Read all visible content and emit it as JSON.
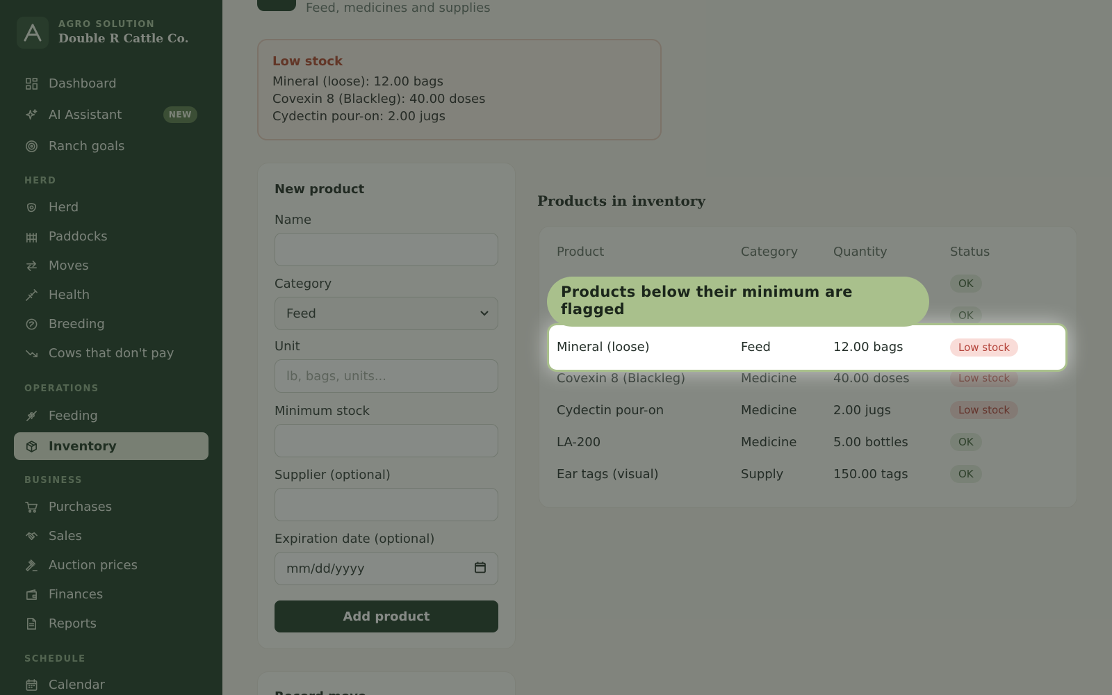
{
  "brand": {
    "kicker": "AGRO SOLUTION",
    "name": "Double R Cattle Co."
  },
  "nav": {
    "dashboard": "Dashboard",
    "ai_assistant": "AI Assistant",
    "new_badge": "NEW",
    "ranch_goals": "Ranch goals",
    "section_herd": "HERD",
    "herd": "Herd",
    "paddocks": "Paddocks",
    "moves": "Moves",
    "health": "Health",
    "breeding": "Breeding",
    "cows_dont_pay": "Cows that don't pay",
    "section_operations": "OPERATIONS",
    "feeding": "Feeding",
    "inventory": "Inventory",
    "section_business": "BUSINESS",
    "purchases": "Purchases",
    "sales": "Sales",
    "auction_prices": "Auction prices",
    "finances": "Finances",
    "reports": "Reports",
    "section_schedule": "SCHEDULE",
    "calendar": "Calendar"
  },
  "header": {
    "subtitle": "Feed, medicines and supplies"
  },
  "alert": {
    "title": "Low stock",
    "lines": [
      "Mineral (loose): 12.00 bags",
      "Covexin 8 (Blackleg): 40.00 doses",
      "Cydectin pour-on: 2.00 jugs"
    ]
  },
  "form": {
    "title": "New product",
    "name_label": "Name",
    "category_label": "Category",
    "category_value": "Feed",
    "unit_label": "Unit",
    "unit_placeholder": "lb, bags, units...",
    "min_stock_label": "Minimum stock",
    "supplier_label": "Supplier (optional)",
    "expiration_label": "Expiration date (optional)",
    "expiration_placeholder": "mm/dd/yyyy",
    "submit": "Add product"
  },
  "record_move": {
    "title": "Record move"
  },
  "inventory": {
    "title": "Products in inventory",
    "headers": [
      "Product",
      "Category",
      "Quantity",
      "Status"
    ],
    "rows": [
      {
        "product": "Mineral (loose)",
        "category": "Feed",
        "quantity": "12.00 bags",
        "status": "Low stock"
      },
      {
        "product": "Covexin 8 (Blackleg)",
        "category": "Medicine",
        "quantity": "40.00 doses",
        "status": "Low stock"
      },
      {
        "product": "Cydectin pour-on",
        "category": "Medicine",
        "quantity": "2.00 jugs",
        "status": "Low stock"
      },
      {
        "product": "LA-200",
        "category": "Medicine",
        "quantity": "5.00 bottles",
        "status": "OK"
      },
      {
        "product": "Ear tags (visual)",
        "category": "Supply",
        "quantity": "150.00 tags",
        "status": "OK"
      }
    ],
    "hidden_statuses": [
      "OK",
      "OK"
    ]
  },
  "tour": {
    "tooltip": "Products below their minimum are flagged"
  },
  "colors": {
    "sidebar": "#1e3a26",
    "accent": "#a9c08c",
    "danger": "#b0452e",
    "ok_badge": "#e3ebdb",
    "low_badge": "#f9dcd8"
  }
}
